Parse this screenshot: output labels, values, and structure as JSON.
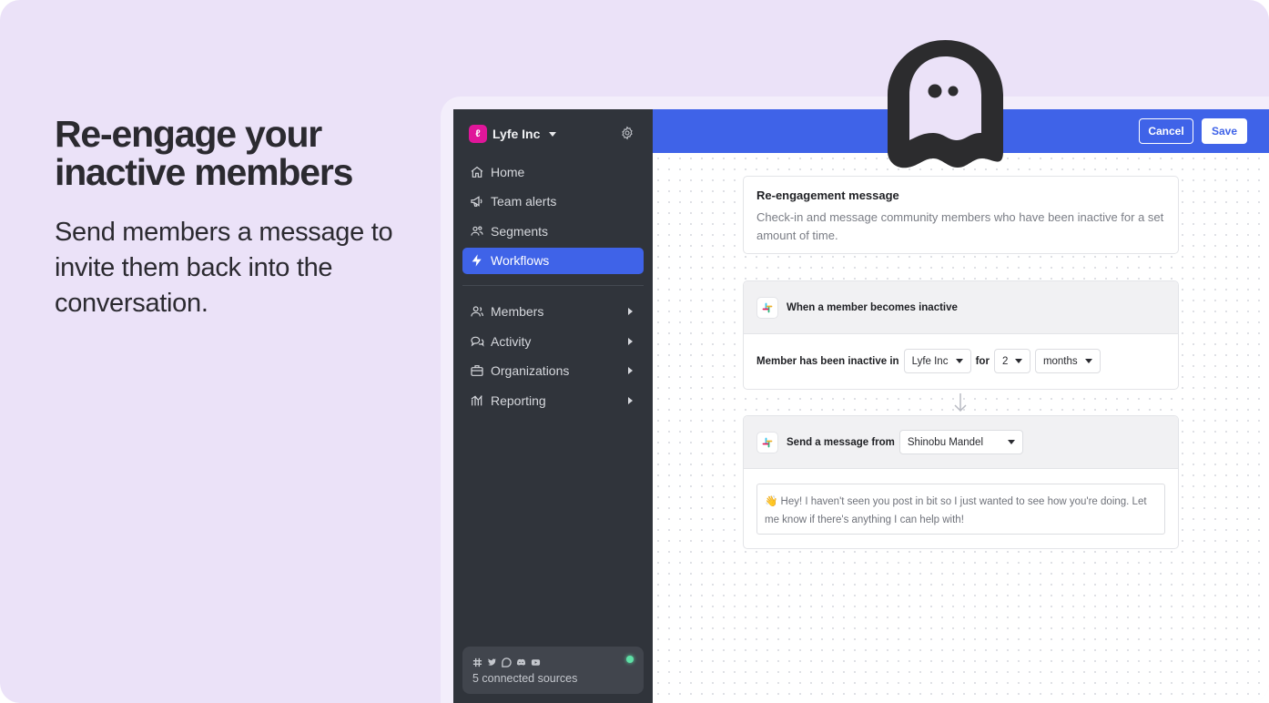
{
  "hero": {
    "title_line1": "Re-engage your",
    "title_line2": "inactive members",
    "subtitle": "Send members a message to invite them back into the conversation."
  },
  "sidebar": {
    "org_initial": "ℓ",
    "org_name": "Lyfe Inc",
    "nav_primary": [
      {
        "label": "Home",
        "icon": "home-icon"
      },
      {
        "label": "Team alerts",
        "icon": "megaphone-icon"
      },
      {
        "label": "Segments",
        "icon": "users-group-icon"
      },
      {
        "label": "Workflows",
        "icon": "lightning-icon",
        "active": true
      }
    ],
    "nav_secondary": [
      {
        "label": "Members",
        "icon": "user-icon"
      },
      {
        "label": "Activity",
        "icon": "chat-bubbles-icon"
      },
      {
        "label": "Organizations",
        "icon": "briefcase-icon"
      },
      {
        "label": "Reporting",
        "icon": "chart-icon"
      }
    ],
    "sources_text": "5 connected sources",
    "source_icons": [
      "slack-icon",
      "twitter-icon",
      "discourse-icon",
      "discord-icon",
      "youtube-icon"
    ]
  },
  "toolbar": {
    "cancel_label": "Cancel",
    "save_label": "Save"
  },
  "workflow": {
    "title": "Re-engagement message",
    "description": "Check-in and message community members who have been inactive for a set amount of time.",
    "trigger_heading": "When a member becomes inactive",
    "condition_label": "Member has been inactive in",
    "condition_org": "Lyfe Inc",
    "condition_for": "for",
    "condition_count": "2",
    "condition_unit": "months",
    "action_heading": "Send a message from",
    "action_sender": "Shinobu Mandel",
    "message": "👋 Hey! I haven't seen you post in bit so I just wanted to see how you're doing. Let me know if there's anything I can help with!"
  },
  "colors": {
    "background": "#ebe2f8",
    "sidebar": "#30343b",
    "accent": "#3f63e8",
    "status_online": "#5ee0a6"
  }
}
